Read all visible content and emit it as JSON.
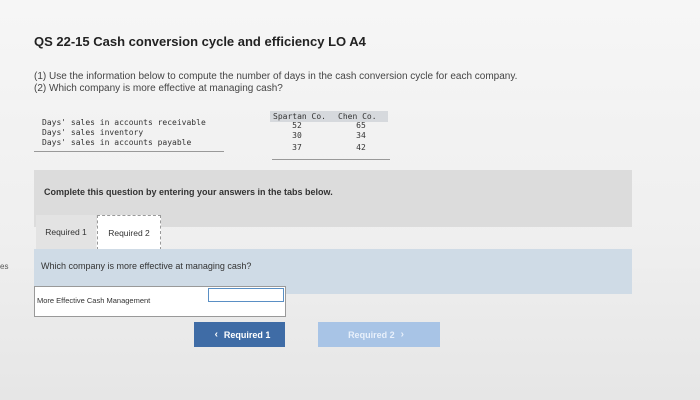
{
  "side_text": "es",
  "title": "QS 22-15 Cash conversion cycle and efficiency LO A4",
  "instructions": [
    "(1) Use the information below to compute the number of days in the cash conversion cycle for each company.",
    "(2) Which company is more effective at managing cash?"
  ],
  "table": {
    "columns": [
      "Spartan Co.",
      "Chen Co."
    ],
    "rows": [
      {
        "label": "Days' sales in accounts receivable",
        "values": [
          "52",
          "65"
        ]
      },
      {
        "label": "Days' sales inventory",
        "values": [
          "30",
          "34"
        ]
      },
      {
        "label": "Days' sales in accounts payable",
        "values": [
          "37",
          "42"
        ]
      }
    ]
  },
  "band_text": "Complete this question by entering your answers in the tabs below.",
  "tabs": [
    {
      "label": "Required 1"
    },
    {
      "label": "Required 2"
    }
  ],
  "question": "Which company is more effective at managing cash?",
  "answer": {
    "label": "More Effective Cash Management",
    "value": ""
  },
  "nav": {
    "prev_label": "Required 1",
    "next_label": "Required 2",
    "prev_icon": "chevron-left-icon",
    "next_icon": "chevron-right-icon"
  },
  "colors": {
    "question_bar": "#cfdbe6",
    "prev_button": "#3f6ca6",
    "next_button_disabled": "#a8c4e6"
  }
}
